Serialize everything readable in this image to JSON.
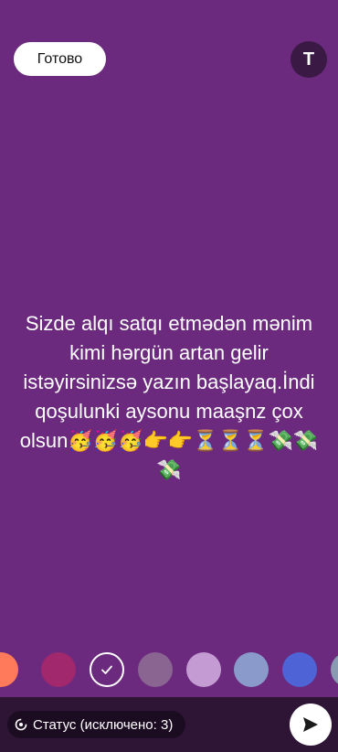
{
  "header": {
    "done_label": "Готово",
    "text_tool_label": "T"
  },
  "status": {
    "text": "Sizde alqı satqı etmədən mənim kimi hərgün artan gelir istəyirsinizsə yazın başlayaq.İndi qoşulunki aysonu maaşnz çox olsun🥳🥳🥳👉👉⏳⏳⏳💸💸💸"
  },
  "palette": {
    "colors": [
      "#ff7a5a",
      "#a2286e",
      "#6b2a7e",
      "#8b6592",
      "#c49bd3",
      "#8a9acb",
      "#4e63d6",
      "#8a9ab0"
    ],
    "selected_index": 2
  },
  "bottom": {
    "audience_label": "Статус (исключено: 3)",
    "send_icon": "send-icon",
    "privacy_icon": "privacy-icon"
  }
}
